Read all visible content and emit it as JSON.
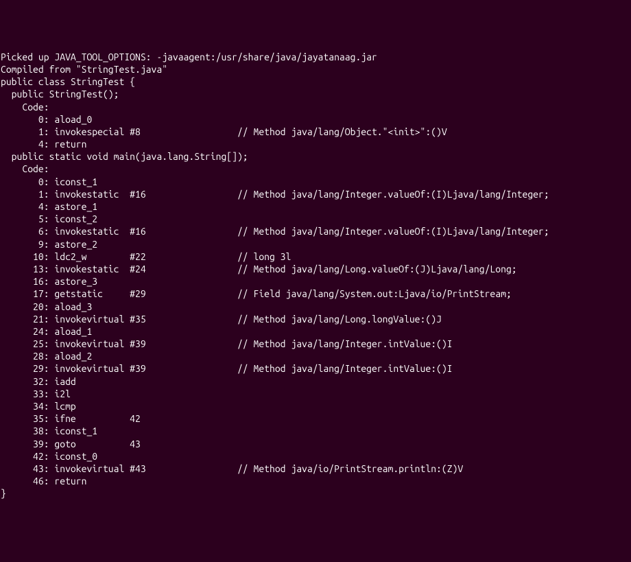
{
  "terminal": {
    "lines": [
      "Picked up JAVA_TOOL_OPTIONS: -javaagent:/usr/share/java/jayatanaag.jar",
      "Compiled from \"StringTest.java\"",
      "public class StringTest {",
      "  public StringTest();",
      "    Code:",
      "       0: aload_0",
      "       1: invokespecial #8                  // Method java/lang/Object.\"<init>\":()V",
      "       4: return",
      "",
      "  public static void main(java.lang.String[]);",
      "    Code:",
      "       0: iconst_1",
      "       1: invokestatic  #16                 // Method java/lang/Integer.valueOf:(I)Ljava/lang/Integer;",
      "       4: astore_1",
      "       5: iconst_2",
      "       6: invokestatic  #16                 // Method java/lang/Integer.valueOf:(I)Ljava/lang/Integer;",
      "       9: astore_2",
      "      10: ldc2_w        #22                 // long 3l",
      "      13: invokestatic  #24                 // Method java/lang/Long.valueOf:(J)Ljava/lang/Long;",
      "      16: astore_3",
      "      17: getstatic     #29                 // Field java/lang/System.out:Ljava/io/PrintStream;",
      "      20: aload_3",
      "      21: invokevirtual #35                 // Method java/lang/Long.longValue:()J",
      "      24: aload_1",
      "      25: invokevirtual #39                 // Method java/lang/Integer.intValue:()I",
      "      28: aload_2",
      "      29: invokevirtual #39                 // Method java/lang/Integer.intValue:()I",
      "      32: iadd",
      "      33: i2l",
      "      34: lcmp",
      "      35: ifne          42",
      "      38: iconst_1",
      "      39: goto          43",
      "      42: iconst_0",
      "      43: invokevirtual #43                 // Method java/io/PrintStream.println:(Z)V",
      "      46: return",
      "}"
    ]
  }
}
